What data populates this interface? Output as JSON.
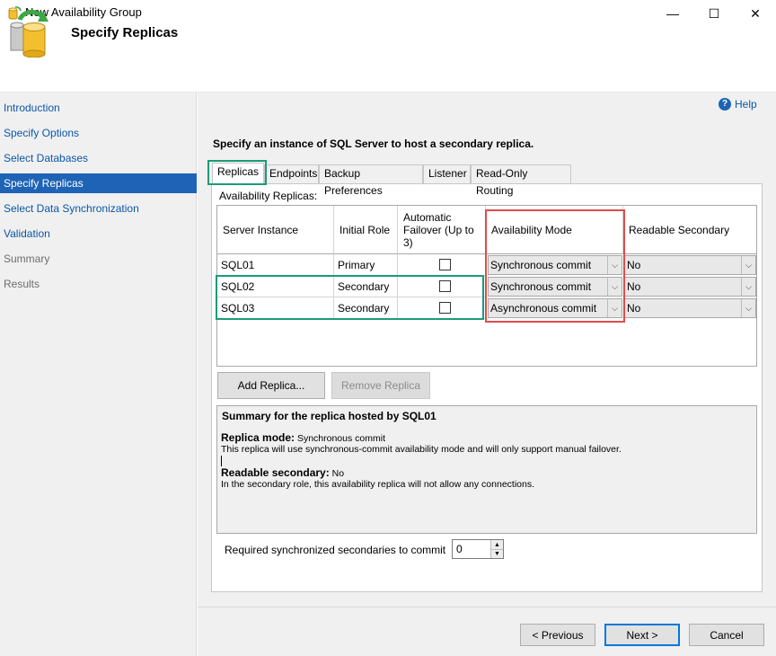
{
  "window": {
    "title": "New Availability Group",
    "min_glyph": "—",
    "max_glyph": "☐",
    "close_glyph": "✕"
  },
  "header": {
    "heading": "Specify Replicas"
  },
  "sidebar": {
    "items": [
      {
        "label": "Introduction",
        "state": "link"
      },
      {
        "label": "Specify Options",
        "state": "link"
      },
      {
        "label": "Select Databases",
        "state": "link"
      },
      {
        "label": "Specify Replicas",
        "state": "active"
      },
      {
        "label": "Select Data Synchronization",
        "state": "link"
      },
      {
        "label": "Validation",
        "state": "link"
      },
      {
        "label": "Summary",
        "state": "disabled"
      },
      {
        "label": "Results",
        "state": "disabled"
      }
    ]
  },
  "help": {
    "label": "Help",
    "icon": "help-icon"
  },
  "main": {
    "instruction": "Specify an instance of SQL Server to host a secondary replica.",
    "tabs": [
      {
        "label": "Replicas",
        "active": true
      },
      {
        "label": "Endpoints",
        "active": false
      },
      {
        "label": "Backup Preferences",
        "active": false
      },
      {
        "label": "Listener",
        "active": false
      },
      {
        "label": "Read-Only Routing",
        "active": false
      }
    ],
    "replicas_label": "Availability Replicas:",
    "grid": {
      "headers": {
        "server_instance": "Server Instance",
        "initial_role": "Initial Role",
        "auto_failover": "Automatic Failover (Up to 3)",
        "availability_mode": "Availability Mode",
        "readable_secondary": "Readable Secondary"
      },
      "rows": [
        {
          "server": "SQL01",
          "role": "Primary",
          "auto_failover": false,
          "mode": "Synchronous commit",
          "readable": "No"
        },
        {
          "server": "SQL02",
          "role": "Secondary",
          "auto_failover": false,
          "mode": "Synchronous commit",
          "readable": "No"
        },
        {
          "server": "SQL03",
          "role": "Secondary",
          "auto_failover": false,
          "mode": "Asynchronous commit",
          "readable": "No"
        }
      ]
    },
    "buttons": {
      "add_replica": "Add Replica...",
      "remove_replica": "Remove Replica"
    },
    "summary": {
      "title": "Summary for the replica hosted by SQL01",
      "mode_label": "Replica mode:",
      "mode_value": "Synchronous commit",
      "mode_desc": "This replica will use synchronous-commit availability mode and will only support manual failover.",
      "readable_label": "Readable secondary:",
      "readable_value": "No",
      "readable_desc": "In the secondary role, this availability replica will not allow any connections."
    },
    "required_sync": {
      "label": "Required synchronized secondaries to commit",
      "value": "0"
    }
  },
  "footer": {
    "previous": "< Previous",
    "next": "Next >",
    "cancel": "Cancel"
  },
  "colors": {
    "accent": "#1e63b5",
    "highlight_green": "#1d9b78",
    "highlight_red": "#e24b4b"
  }
}
